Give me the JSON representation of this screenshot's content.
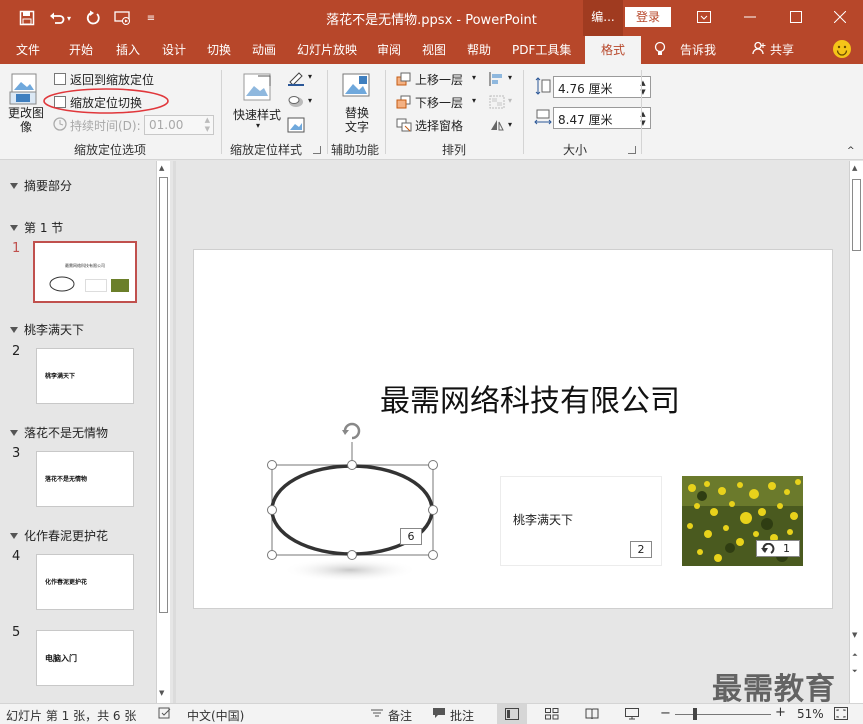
{
  "window": {
    "title": "落花不是无情物.ppsx  -  PowerPoint",
    "context_tab_title": "编...",
    "login_label": "登录"
  },
  "tabs": [
    "文件",
    "开始",
    "插入",
    "设计",
    "切换",
    "动画",
    "幻灯片放映",
    "审阅",
    "视图",
    "帮助",
    "PDF工具集",
    "格式"
  ],
  "tell_me": "告诉我",
  "share": "共享",
  "ribbon": {
    "change_image": "更改图像",
    "return_to_zoom": "返回到缩放定位",
    "zoom_transition": "缩放定位切换",
    "duration_label": "持续时间(D):",
    "duration_value": "01.00",
    "group_zoom_options": "缩放定位选项",
    "quick_styles": "快速样式",
    "group_zoom_styles": "缩放定位样式",
    "alt_text": "替换文字",
    "group_accessibility": "辅助功能",
    "bring_forward": "上移一层",
    "send_backward": "下移一层",
    "selection_pane": "选择窗格",
    "group_arrange": "排列",
    "height_value": "4.76 厘米",
    "width_value": "8.47 厘米",
    "group_size": "大小"
  },
  "sections": [
    {
      "name": "摘要部分"
    },
    {
      "name": "第 1 节"
    },
    {
      "name": "桃李满天下"
    },
    {
      "name": "落花不是无情物"
    },
    {
      "name": "化作春泥更护花"
    }
  ],
  "slides": [
    {
      "num": "1",
      "thumb_text": "最需网络科技有限公司"
    },
    {
      "num": "2",
      "thumb_text": "桃李满天下"
    },
    {
      "num": "3",
      "thumb_text": "落花不是无情物"
    },
    {
      "num": "4",
      "thumb_text": "化作春泥更护花"
    },
    {
      "num": "5",
      "thumb_text": "电脑入门"
    }
  ],
  "slide_main": {
    "title": "最需网络科技有限公司",
    "zoom1_number": "6",
    "zoom2_text": "桃李满天下",
    "zoom2_number": "2",
    "zoom3_number": "1"
  },
  "status": {
    "slide_info": "幻灯片 第 1 张，共 6 张",
    "language": "中文(中国)",
    "notes": "备注",
    "comments": "批注",
    "zoom_pct": "51%"
  },
  "watermark": "最需教育",
  "colors": {
    "accent": "#b7472a",
    "highlight_red": "#e0373b",
    "thumb_selected": "#c0504d"
  }
}
